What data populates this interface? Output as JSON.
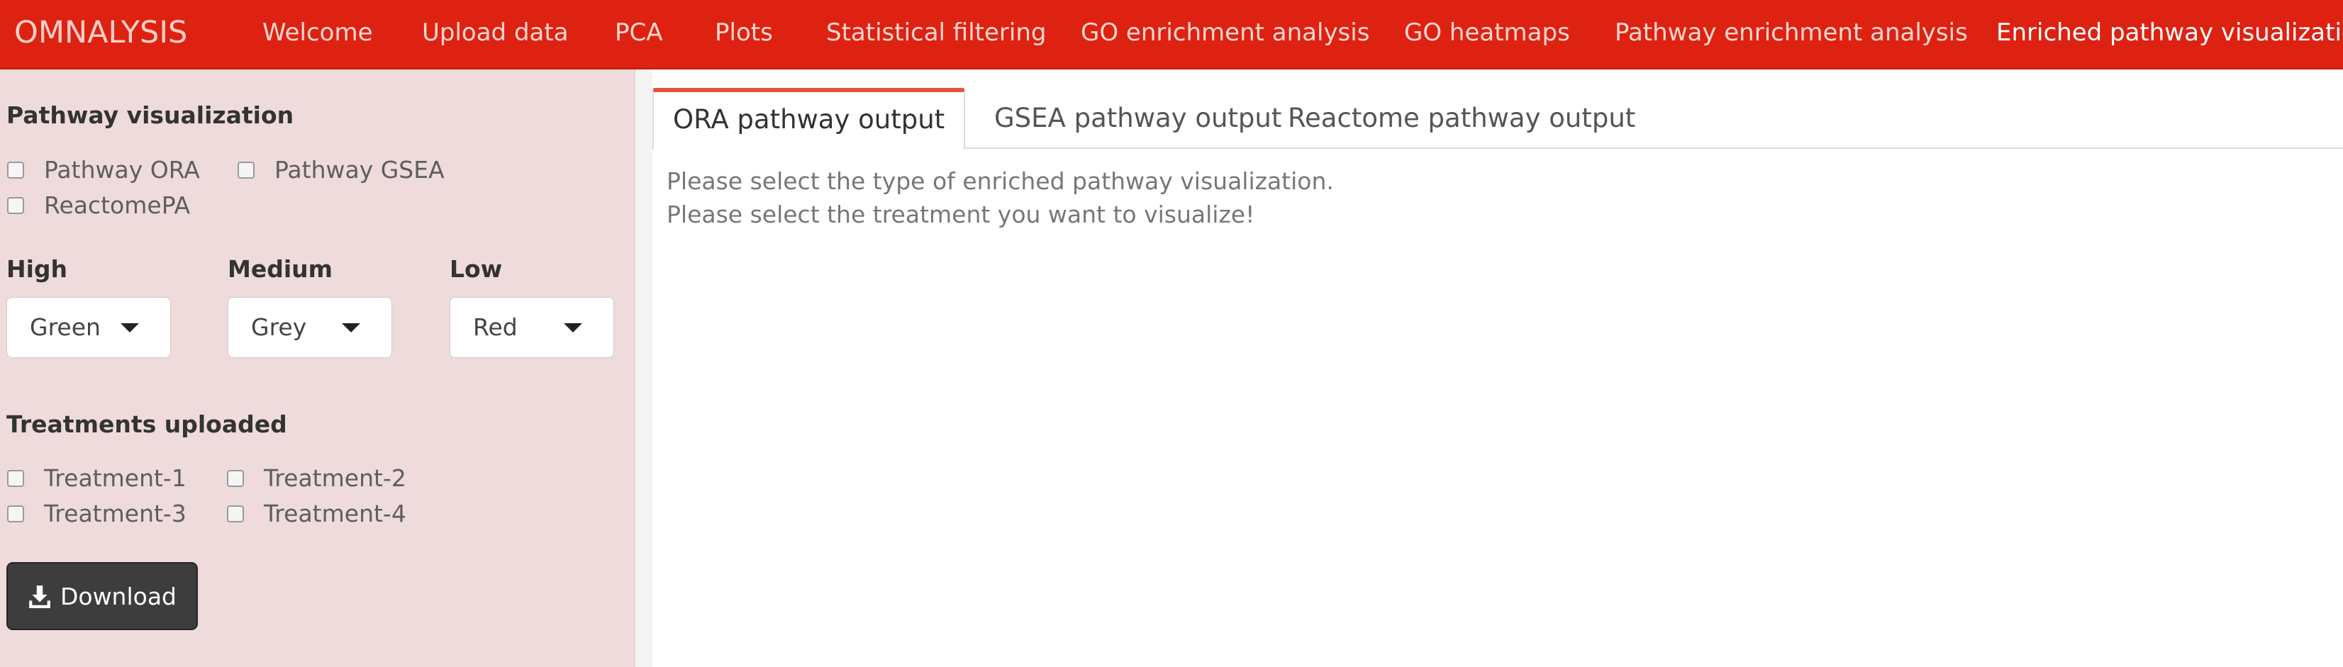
{
  "navbar": {
    "brand": "OMNALYSIS",
    "items": [
      {
        "label": "Welcome"
      },
      {
        "label": "Upload data"
      },
      {
        "label": "PCA"
      },
      {
        "label": "Plots"
      },
      {
        "label": "Statistical filtering"
      },
      {
        "label": "GO enrichment analysis"
      },
      {
        "label": "GO heatmaps"
      },
      {
        "label": "Pathway enrichment analysis"
      },
      {
        "label": "Enriched pathway visualization"
      }
    ],
    "active_index": 8,
    "color": "#dd2212"
  },
  "sidebar": {
    "background": "#efdbdb",
    "pathway_viz": {
      "heading": "Pathway visualization",
      "options": [
        {
          "label": "Pathway ORA",
          "checked": false
        },
        {
          "label": "Pathway GSEA",
          "checked": false
        },
        {
          "label": "ReactomePA",
          "checked": false
        }
      ]
    },
    "colors": {
      "high": {
        "label": "High",
        "value": "Green"
      },
      "medium": {
        "label": "Medium",
        "value": "Grey"
      },
      "low": {
        "label": "Low",
        "value": "Red"
      }
    },
    "treatments": {
      "heading": "Treatments uploaded",
      "options": [
        {
          "label": "Treatment-1",
          "checked": false
        },
        {
          "label": "Treatment-2",
          "checked": false
        },
        {
          "label": "Treatment-3",
          "checked": false
        },
        {
          "label": "Treatment-4",
          "checked": false
        }
      ]
    },
    "download_label": "Download",
    "download_icon": "download-icon"
  },
  "main": {
    "tabs": [
      {
        "label": "ORA pathway output"
      },
      {
        "label": "GSEA pathway output"
      },
      {
        "label": "Reactome pathway output"
      }
    ],
    "active_tab": 0,
    "messages": [
      "Please select the type of enriched pathway visualization.",
      "Please select the treatment you want to visualize!"
    ]
  }
}
